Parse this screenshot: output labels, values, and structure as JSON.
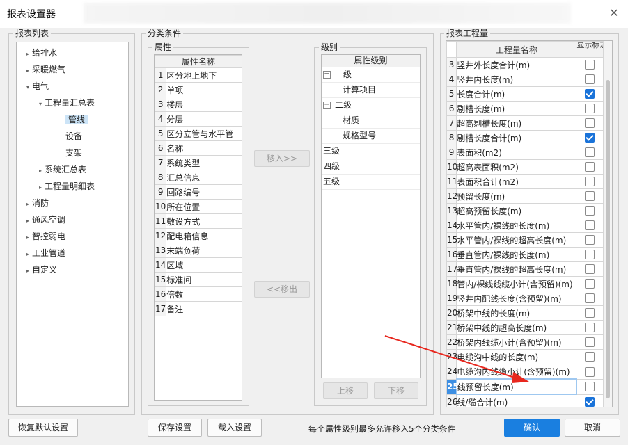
{
  "window": {
    "title": "报表设置器",
    "close_icon": "close-icon"
  },
  "report_list": {
    "label": "报表列表",
    "items": [
      "给排水",
      "采暖燃气",
      "电气",
      "工程量汇总表",
      "管线",
      "设备",
      "支架",
      "系统汇总表",
      "工程量明细表",
      "消防",
      "通风空调",
      "智控弱电",
      "工业管道",
      "自定义"
    ],
    "selected": "管线"
  },
  "conditions": {
    "label": "分类条件",
    "attributes": {
      "label": "属性",
      "header": "属性名称",
      "rows": [
        {
          "no": "1",
          "name": "区分地上地下"
        },
        {
          "no": "2",
          "name": "单项"
        },
        {
          "no": "3",
          "name": "楼层"
        },
        {
          "no": "4",
          "name": "分层"
        },
        {
          "no": "5",
          "name": "区分立管与水平管"
        },
        {
          "no": "6",
          "name": "名称"
        },
        {
          "no": "7",
          "name": "系统类型"
        },
        {
          "no": "8",
          "name": "汇总信息"
        },
        {
          "no": "9",
          "name": "回路编号"
        },
        {
          "no": "10",
          "name": "所在位置"
        },
        {
          "no": "11",
          "name": "敷设方式"
        },
        {
          "no": "12",
          "name": "配电箱信息"
        },
        {
          "no": "13",
          "name": "末端负荷"
        },
        {
          "no": "14",
          "name": "区域"
        },
        {
          "no": "15",
          "name": "标准间"
        },
        {
          "no": "16",
          "name": "倍数"
        },
        {
          "no": "17",
          "name": "备注"
        }
      ]
    },
    "move_in": "移入>>",
    "move_out": "<<移出",
    "levels": {
      "label": "级别",
      "header": "属性级别",
      "items": [
        "一级",
        "计算项目",
        "二级",
        "材质",
        "规格型号",
        "三级",
        "四级",
        "五级"
      ]
    },
    "move_up": "上移",
    "move_down": "下移"
  },
  "quantities": {
    "label": "报表工程量",
    "header_name": "工程量名称",
    "header_show": "显示标志",
    "rows": [
      {
        "no": "3",
        "name": "竖井外长度合计(m)",
        "checked": false
      },
      {
        "no": "4",
        "name": "竖井内长度(m)",
        "checked": false
      },
      {
        "no": "5",
        "name": "长度合计(m)",
        "checked": true
      },
      {
        "no": "6",
        "name": "剔槽长度(m)",
        "checked": false
      },
      {
        "no": "7",
        "name": "超高剔槽长度(m)",
        "checked": false
      },
      {
        "no": "8",
        "name": "剔槽长度合计(m)",
        "checked": true
      },
      {
        "no": "9",
        "name": "表面积(m2)",
        "checked": false
      },
      {
        "no": "10",
        "name": "超高表面积(m2)",
        "checked": false
      },
      {
        "no": "11",
        "name": "表面积合计(m2)",
        "checked": false
      },
      {
        "no": "12",
        "name": "预留长度(m)",
        "checked": false
      },
      {
        "no": "13",
        "name": "超高预留长度(m)",
        "checked": false
      },
      {
        "no": "14",
        "name": "水平管内/裸线的长度(m)",
        "checked": false
      },
      {
        "no": "15",
        "name": "水平管内/裸线的超高长度(m)",
        "checked": false
      },
      {
        "no": "16",
        "name": "垂直管内/裸线的长度(m)",
        "checked": false
      },
      {
        "no": "17",
        "name": "垂直管内/裸线的超高长度(m)",
        "checked": false
      },
      {
        "no": "18",
        "name": "管内/裸线线缆小计(含预留)(m)",
        "checked": false
      },
      {
        "no": "19",
        "name": "竖井内配线长度(含预留)(m)",
        "checked": false
      },
      {
        "no": "20",
        "name": "桥架中线的长度(m)",
        "checked": false
      },
      {
        "no": "21",
        "name": "桥架中线的超高长度(m)",
        "checked": false
      },
      {
        "no": "22",
        "name": "桥架内线缆小计(含预留)(m)",
        "checked": false
      },
      {
        "no": "23",
        "name": "电缆沟中线的长度(m)",
        "checked": false
      },
      {
        "no": "24",
        "name": "电缆沟内线缆小计(含预留)(m)",
        "checked": false
      },
      {
        "no": "25",
        "name": "线预留长度(m)",
        "checked": false
      },
      {
        "no": "26",
        "name": "线/缆合计(m)",
        "checked": true
      }
    ],
    "highlight_row": "25"
  },
  "footer": {
    "restore": "恢复默认设置",
    "save": "保存设置",
    "load": "载入设置",
    "hint": "每个属性级别最多允许移入5个分类条件",
    "ok": "确认",
    "cancel": "取消"
  },
  "colors": {
    "accent": "#1a7fe0",
    "header_blue": "#3d8fe3",
    "arrow": "#e8271e",
    "selection": "#cce4f7"
  }
}
